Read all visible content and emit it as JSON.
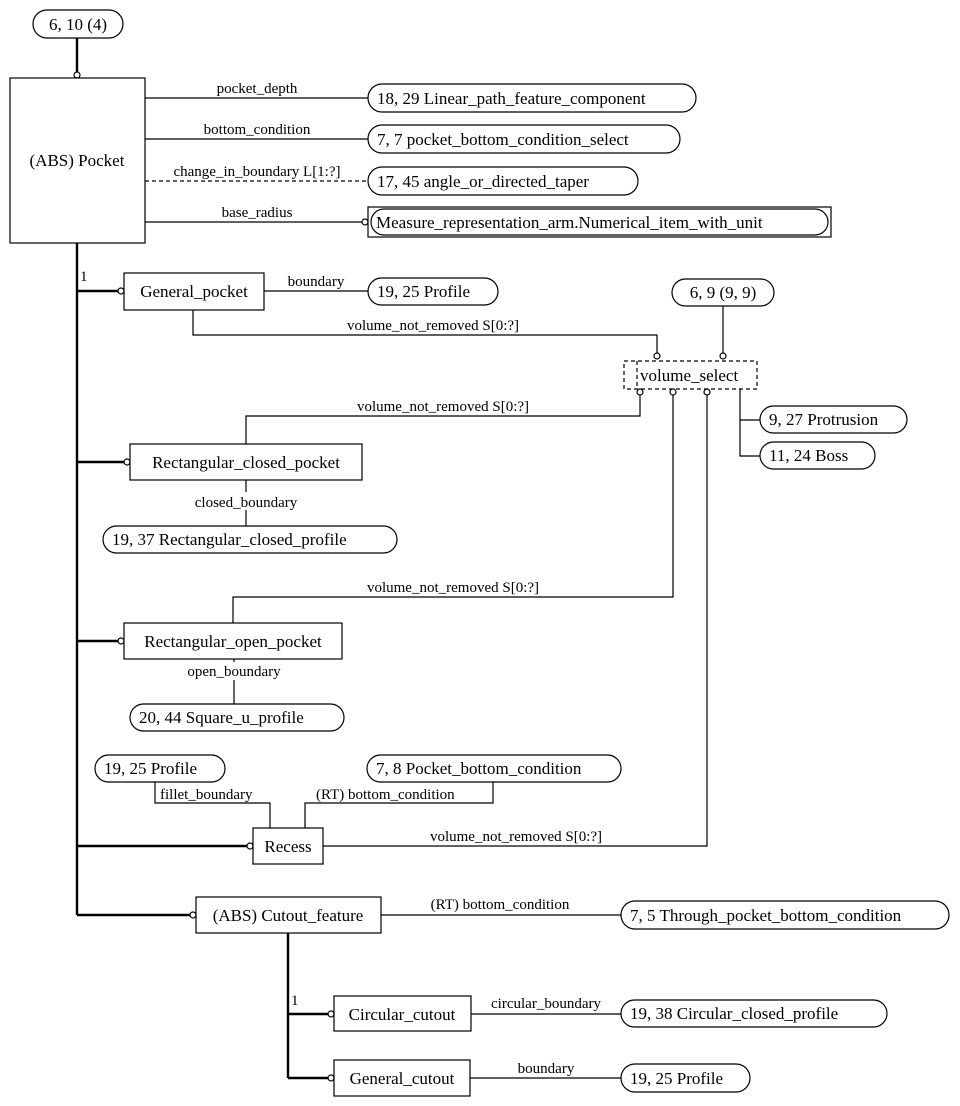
{
  "diagram": {
    "page_ref": "6, 10 (4)",
    "pocket": {
      "label": "(ABS) Pocket",
      "supertype_count": "1"
    },
    "attributes": [
      {
        "name": "pocket_depth",
        "target": "18, 29 Linear_path_feature_component"
      },
      {
        "name": "bottom_condition",
        "target": "7, 7 pocket_bottom_condition_select"
      },
      {
        "name": "change_in_boundary L[1:?]",
        "target": "17, 45 angle_or_directed_taper",
        "optional": true
      },
      {
        "name": "base_radius",
        "target": "Measure_representation_arm.Numerical_item_with_unit"
      }
    ],
    "general_pocket": {
      "label": "General_pocket",
      "attr": "boundary",
      "target": "19, 25 Profile",
      "volume_attr": "volume_not_removed S[0:?]"
    },
    "volume_select": {
      "label": "volume_select",
      "page_ref": "6, 9 (9, 9)",
      "subtypes": [
        "9, 27 Protrusion",
        "11, 24 Boss"
      ]
    },
    "rectangular_closed_pocket": {
      "label": "Rectangular_closed_pocket",
      "attr": "closed_boundary",
      "target": "19, 37 Rectangular_closed_profile",
      "volume_attr": "volume_not_removed S[0:?]"
    },
    "rectangular_open_pocket": {
      "label": "Rectangular_open_pocket",
      "attr": "open_boundary",
      "target": "20, 44 Square_u_profile",
      "volume_attr": "volume_not_removed S[0:?]"
    },
    "recess": {
      "label": "Recess",
      "fillet_attr": "fillet_boundary",
      "fillet_target": "19, 25 Profile",
      "bottom_attr": "(RT) bottom_condition",
      "bottom_target": "7, 8 Pocket_bottom_condition",
      "volume_attr": "volume_not_removed S[0:?]"
    },
    "cutout_feature": {
      "label": "(ABS) Cutout_feature",
      "attr": "(RT) bottom_condition",
      "target": "7, 5 Through_pocket_bottom_condition",
      "supertype_count": "1"
    },
    "circular_cutout": {
      "label": "Circular_cutout",
      "attr": "circular_boundary",
      "target": "19, 38 Circular_closed_profile"
    },
    "general_cutout": {
      "label": "General_cutout",
      "attr": "boundary",
      "target": "19, 25 Profile"
    }
  }
}
